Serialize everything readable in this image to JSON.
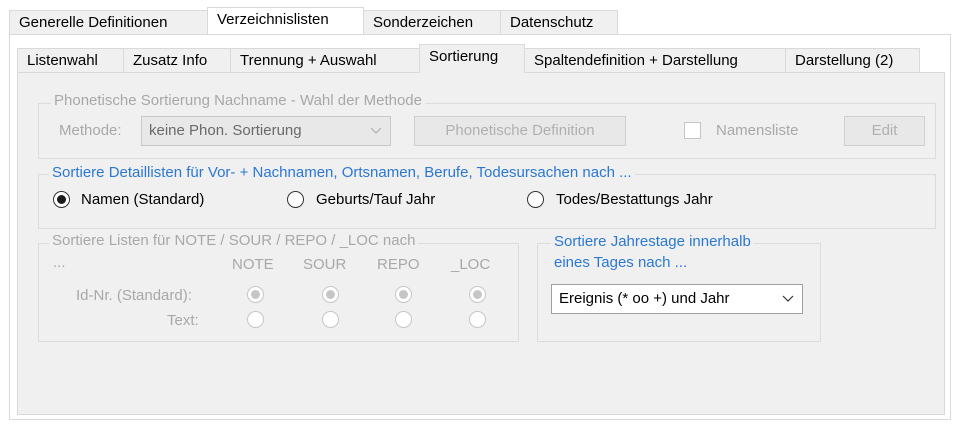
{
  "outer_tabs": [
    "Generelle Definitionen",
    "Verzeichnislisten",
    "Sonderzeichen",
    "Datenschutz"
  ],
  "inner_tabs": [
    "Listenwahl",
    "Zusatz Info",
    "Trennung + Auswahl",
    "Sortierung",
    "Spaltendefinition + Darstellung",
    "Darstellung (2)"
  ],
  "phonetic": {
    "legend": "Phonetische Sortierung Nachname - Wahl der Methode",
    "method_label": "Methode:",
    "method_value": "keine Phon. Sortierung",
    "definition_button": "Phonetische Definition",
    "names_list_label": "Namensliste",
    "edit_button": "Edit"
  },
  "detail_sort": {
    "legend": "Sortiere Detaillisten für Vor- + Nachnamen, Ortsnamen, Berufe, Todesursachen nach ...",
    "options": [
      "Namen (Standard)",
      "Geburts/Tauf Jahr",
      "Todes/Bestattungs Jahr"
    ],
    "selected": "Namen (Standard)"
  },
  "list_sort": {
    "legend": "Sortiere Listen für NOTE / SOUR / REPO / _LOC nach",
    "legend_cont": "...",
    "columns": [
      "NOTE",
      "SOUR",
      "REPO",
      "_LOC"
    ],
    "rows": [
      "Id-Nr. (Standard):",
      "Text:"
    ]
  },
  "anniversary": {
    "legend_line1": "Sortiere Jahrestage innerhalb",
    "legend_line2": "eines Tages nach ...",
    "value": "Ereignis (* oo +) und Jahr"
  },
  "icons": {
    "dropdown": "chevron-down-icon"
  }
}
